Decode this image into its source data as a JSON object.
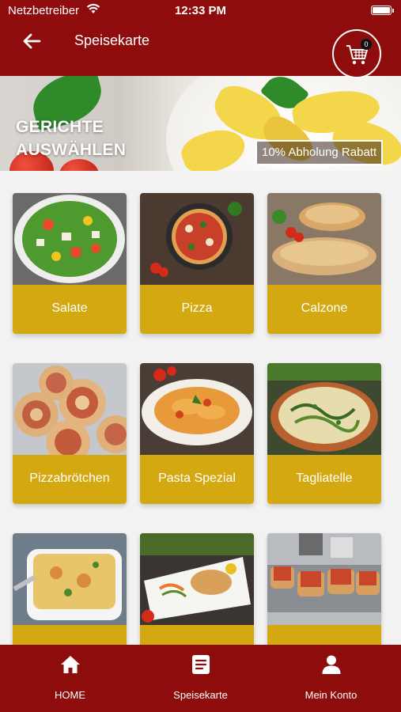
{
  "status_bar": {
    "carrier": "Netzbetreiber",
    "time": "12:33 PM"
  },
  "header": {
    "title": "Speisekarte",
    "cart_count": "0"
  },
  "banner": {
    "title_line1": "GERICHTE",
    "title_line2": "AUSWÄHLEN",
    "promo": "10% Abholung Rabatt"
  },
  "categories": [
    {
      "label": "Salate"
    },
    {
      "label": "Pizza"
    },
    {
      "label": "Calzone"
    },
    {
      "label": "Pizzabrötchen"
    },
    {
      "label": "Pasta Spezial"
    },
    {
      "label": "Tagliatelle"
    },
    {
      "label": ""
    },
    {
      "label": ""
    },
    {
      "label": ""
    }
  ],
  "bottom_nav": {
    "items": [
      {
        "label": "HOME",
        "icon": "home-icon"
      },
      {
        "label": "Speisekarte",
        "icon": "menu-list-icon"
      },
      {
        "label": "Mein Konto",
        "icon": "user-icon"
      }
    ]
  },
  "colors": {
    "brand_red": "#8e0c0c",
    "card_gold": "#d4a810",
    "background": "#f2f2f2"
  }
}
